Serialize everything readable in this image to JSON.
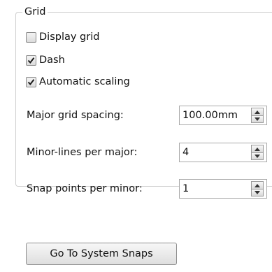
{
  "group": {
    "title": "Grid"
  },
  "checkboxes": [
    {
      "label": "Display grid",
      "checked": false
    },
    {
      "label": "Dash",
      "checked": true
    },
    {
      "label": "Automatic scaling",
      "checked": true
    }
  ],
  "fields": {
    "major_spacing": {
      "label": "Major grid spacing:",
      "value": "100.00mm"
    },
    "minor_lines": {
      "label": "Minor-lines per major:",
      "value": "4"
    },
    "snap_points": {
      "label": "Snap points per minor:",
      "value": "1"
    }
  },
  "button": {
    "label": "Go To System Snaps"
  }
}
